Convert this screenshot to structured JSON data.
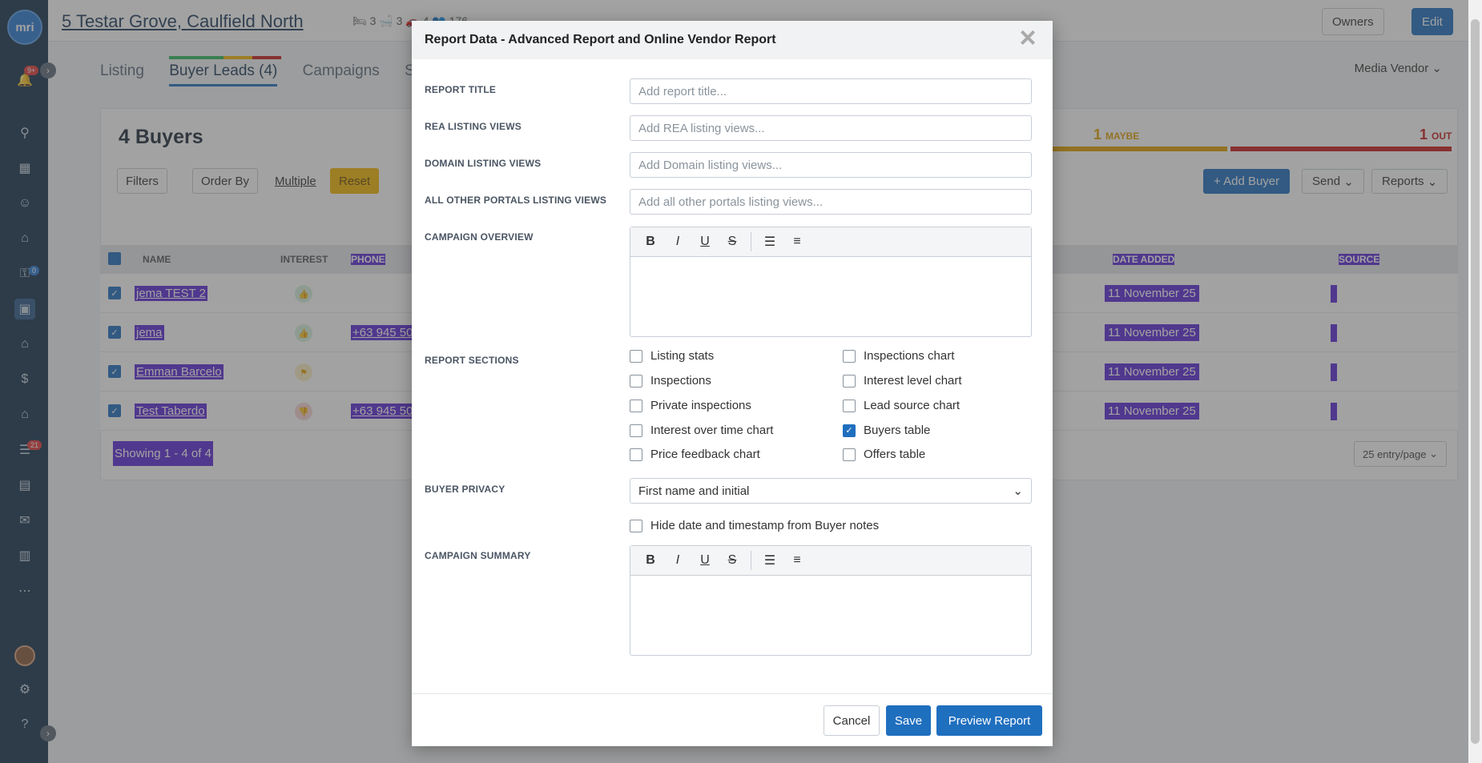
{
  "rail": {
    "logo": "mri",
    "notifications_badge": "9+",
    "badge_a": "0",
    "badge_b": "21"
  },
  "header": {
    "address": "5 Testar Grove, Caulfield North",
    "stats": "🛏 3   🛁 3   🚗 4   👥 176",
    "owners_label": "Owners",
    "edit_label": "Edit"
  },
  "tabs": [
    "Listing",
    "Buyer Leads (4)",
    "Campaigns",
    "S"
  ],
  "media_vendor": "Media Vendor",
  "buyers": {
    "title": "4 Buyers",
    "filters": "Filters",
    "order_by": "Order By",
    "multiple": "Multiple",
    "reset": "Reset",
    "maybe_count": "1",
    "maybe_label": "MAYBE",
    "out_count": "1",
    "out_label": "OUT",
    "add_buyer": "+ Add Buyer",
    "send": "Send",
    "reports": "Reports",
    "columns": {
      "name": "NAME",
      "interest": "INTEREST",
      "phone": "PHONE",
      "date_added": "DATE ADDED",
      "source": "SOURCE"
    },
    "rows": [
      {
        "name": "jema TEST 2",
        "interest": "up",
        "phone": "",
        "date": "11 November 25"
      },
      {
        "name": "jema",
        "interest": "up",
        "phone": "+63 945 50",
        "date": "11 November 25"
      },
      {
        "name": "Emman Barcelo",
        "interest": "maybe",
        "phone": "",
        "date": "11 November 25"
      },
      {
        "name": "Test Taberdo",
        "interest": "down",
        "phone": "+63 945 50",
        "date": "11 November 25"
      }
    ],
    "showing": "Showing 1 - 4 of 4",
    "per_page": "25 entry/page"
  },
  "modal": {
    "title": "Report Data - Advanced Report and Online Vendor Report",
    "fields": {
      "report_title": {
        "label": "REPORT TITLE",
        "placeholder": "Add report title..."
      },
      "rea_views": {
        "label": "REA LISTING VIEWS",
        "placeholder": "Add REA listing views..."
      },
      "domain_views": {
        "label": "DOMAIN LISTING VIEWS",
        "placeholder": "Add Domain listing views..."
      },
      "other_views": {
        "label": "ALL OTHER PORTALS LISTING VIEWS",
        "placeholder": "Add all other portals listing views..."
      }
    },
    "campaign_overview_label": "CAMPAIGN OVERVIEW",
    "report_sections_label": "REPORT SECTIONS",
    "sections": [
      {
        "label": "Listing stats",
        "checked": false
      },
      {
        "label": "Inspections chart",
        "checked": false
      },
      {
        "label": "Inspections",
        "checked": false
      },
      {
        "label": "Interest level chart",
        "checked": false
      },
      {
        "label": "Private inspections",
        "checked": false
      },
      {
        "label": "Lead source chart",
        "checked": false
      },
      {
        "label": "Interest over time chart",
        "checked": false
      },
      {
        "label": "Buyers table",
        "checked": true
      },
      {
        "label": "Price feedback chart",
        "checked": false
      },
      {
        "label": "Offers table",
        "checked": false
      }
    ],
    "buyer_privacy_label": "BUYER PRIVACY",
    "buyer_privacy_value": "First name and initial",
    "hide_timestamp_label": "Hide date and timestamp from Buyer notes",
    "campaign_summary_label": "CAMPAIGN SUMMARY",
    "buttons": {
      "cancel": "Cancel",
      "save": "Save",
      "preview": "Preview Report"
    }
  },
  "colors": {
    "accent": "#1f6fbf",
    "highlight": "#5b2bd6",
    "maybe": "#e0a000",
    "out": "#c81c1c",
    "positive": "#2eb85c"
  }
}
